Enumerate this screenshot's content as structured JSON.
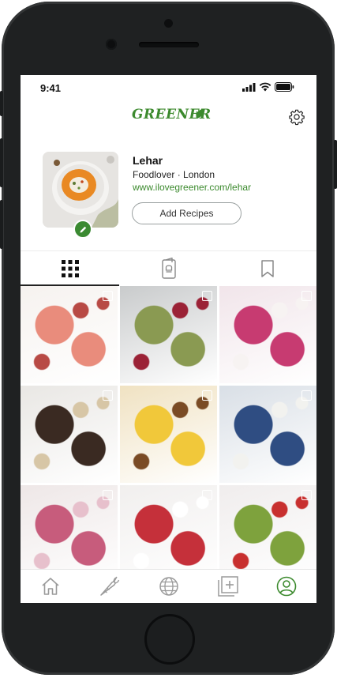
{
  "status_bar": {
    "time": "9:41"
  },
  "header": {
    "logo_text": "GREENER"
  },
  "profile": {
    "name": "Lehar",
    "bio": "Foodlover · London",
    "website": "www.ilovegreener.com/lehar",
    "add_button_label": "Add Recipes"
  },
  "tabs": [
    {
      "icon": "grid-icon",
      "active": true
    },
    {
      "icon": "recipe-card-icon",
      "active": false
    },
    {
      "icon": "bookmark-icon",
      "active": false
    }
  ],
  "grid": [
    {
      "name": "cherry-tart-slices",
      "colors": [
        "#f6f2ef",
        "#e98c7c",
        "#b84a45"
      ]
    },
    {
      "name": "matcha-cherry-cake",
      "colors": [
        "#c9cbcc",
        "#8a9a52",
        "#9b2236"
      ]
    },
    {
      "name": "chia-yogurt-cups",
      "colors": [
        "#f1e5ea",
        "#c73b71",
        "#f7f3f2"
      ]
    },
    {
      "name": "chocolate-tarts",
      "colors": [
        "#e9e7e4",
        "#3a2a22",
        "#d7c6a6"
      ]
    },
    {
      "name": "pumpkin-buns",
      "colors": [
        "#f0e2c2",
        "#f1c83a",
        "#7a4b25"
      ]
    },
    {
      "name": "blue-swirl-buns",
      "colors": [
        "#d9dfe6",
        "#2f4d82",
        "#f2f2ef"
      ]
    },
    {
      "name": "rose-tart",
      "colors": [
        "#eee7e7",
        "#c75c7c",
        "#e7c0cc"
      ]
    },
    {
      "name": "red-velvet-cake",
      "colors": [
        "#f1efee",
        "#c5303a",
        "#ffffff"
      ]
    },
    {
      "name": "christmas-tree-dessert",
      "colors": [
        "#f0eded",
        "#7ea23d",
        "#c8302f"
      ]
    }
  ],
  "bottom_nav": [
    {
      "icon": "home-icon",
      "active": false
    },
    {
      "icon": "carrot-icon",
      "active": false
    },
    {
      "icon": "globe-icon",
      "active": false
    },
    {
      "icon": "add-post-icon",
      "active": false
    },
    {
      "icon": "profile-icon",
      "active": true
    }
  ],
  "colors": {
    "brand_green": "#3c8a2e",
    "inactive_icon": "#9a9a9a"
  }
}
